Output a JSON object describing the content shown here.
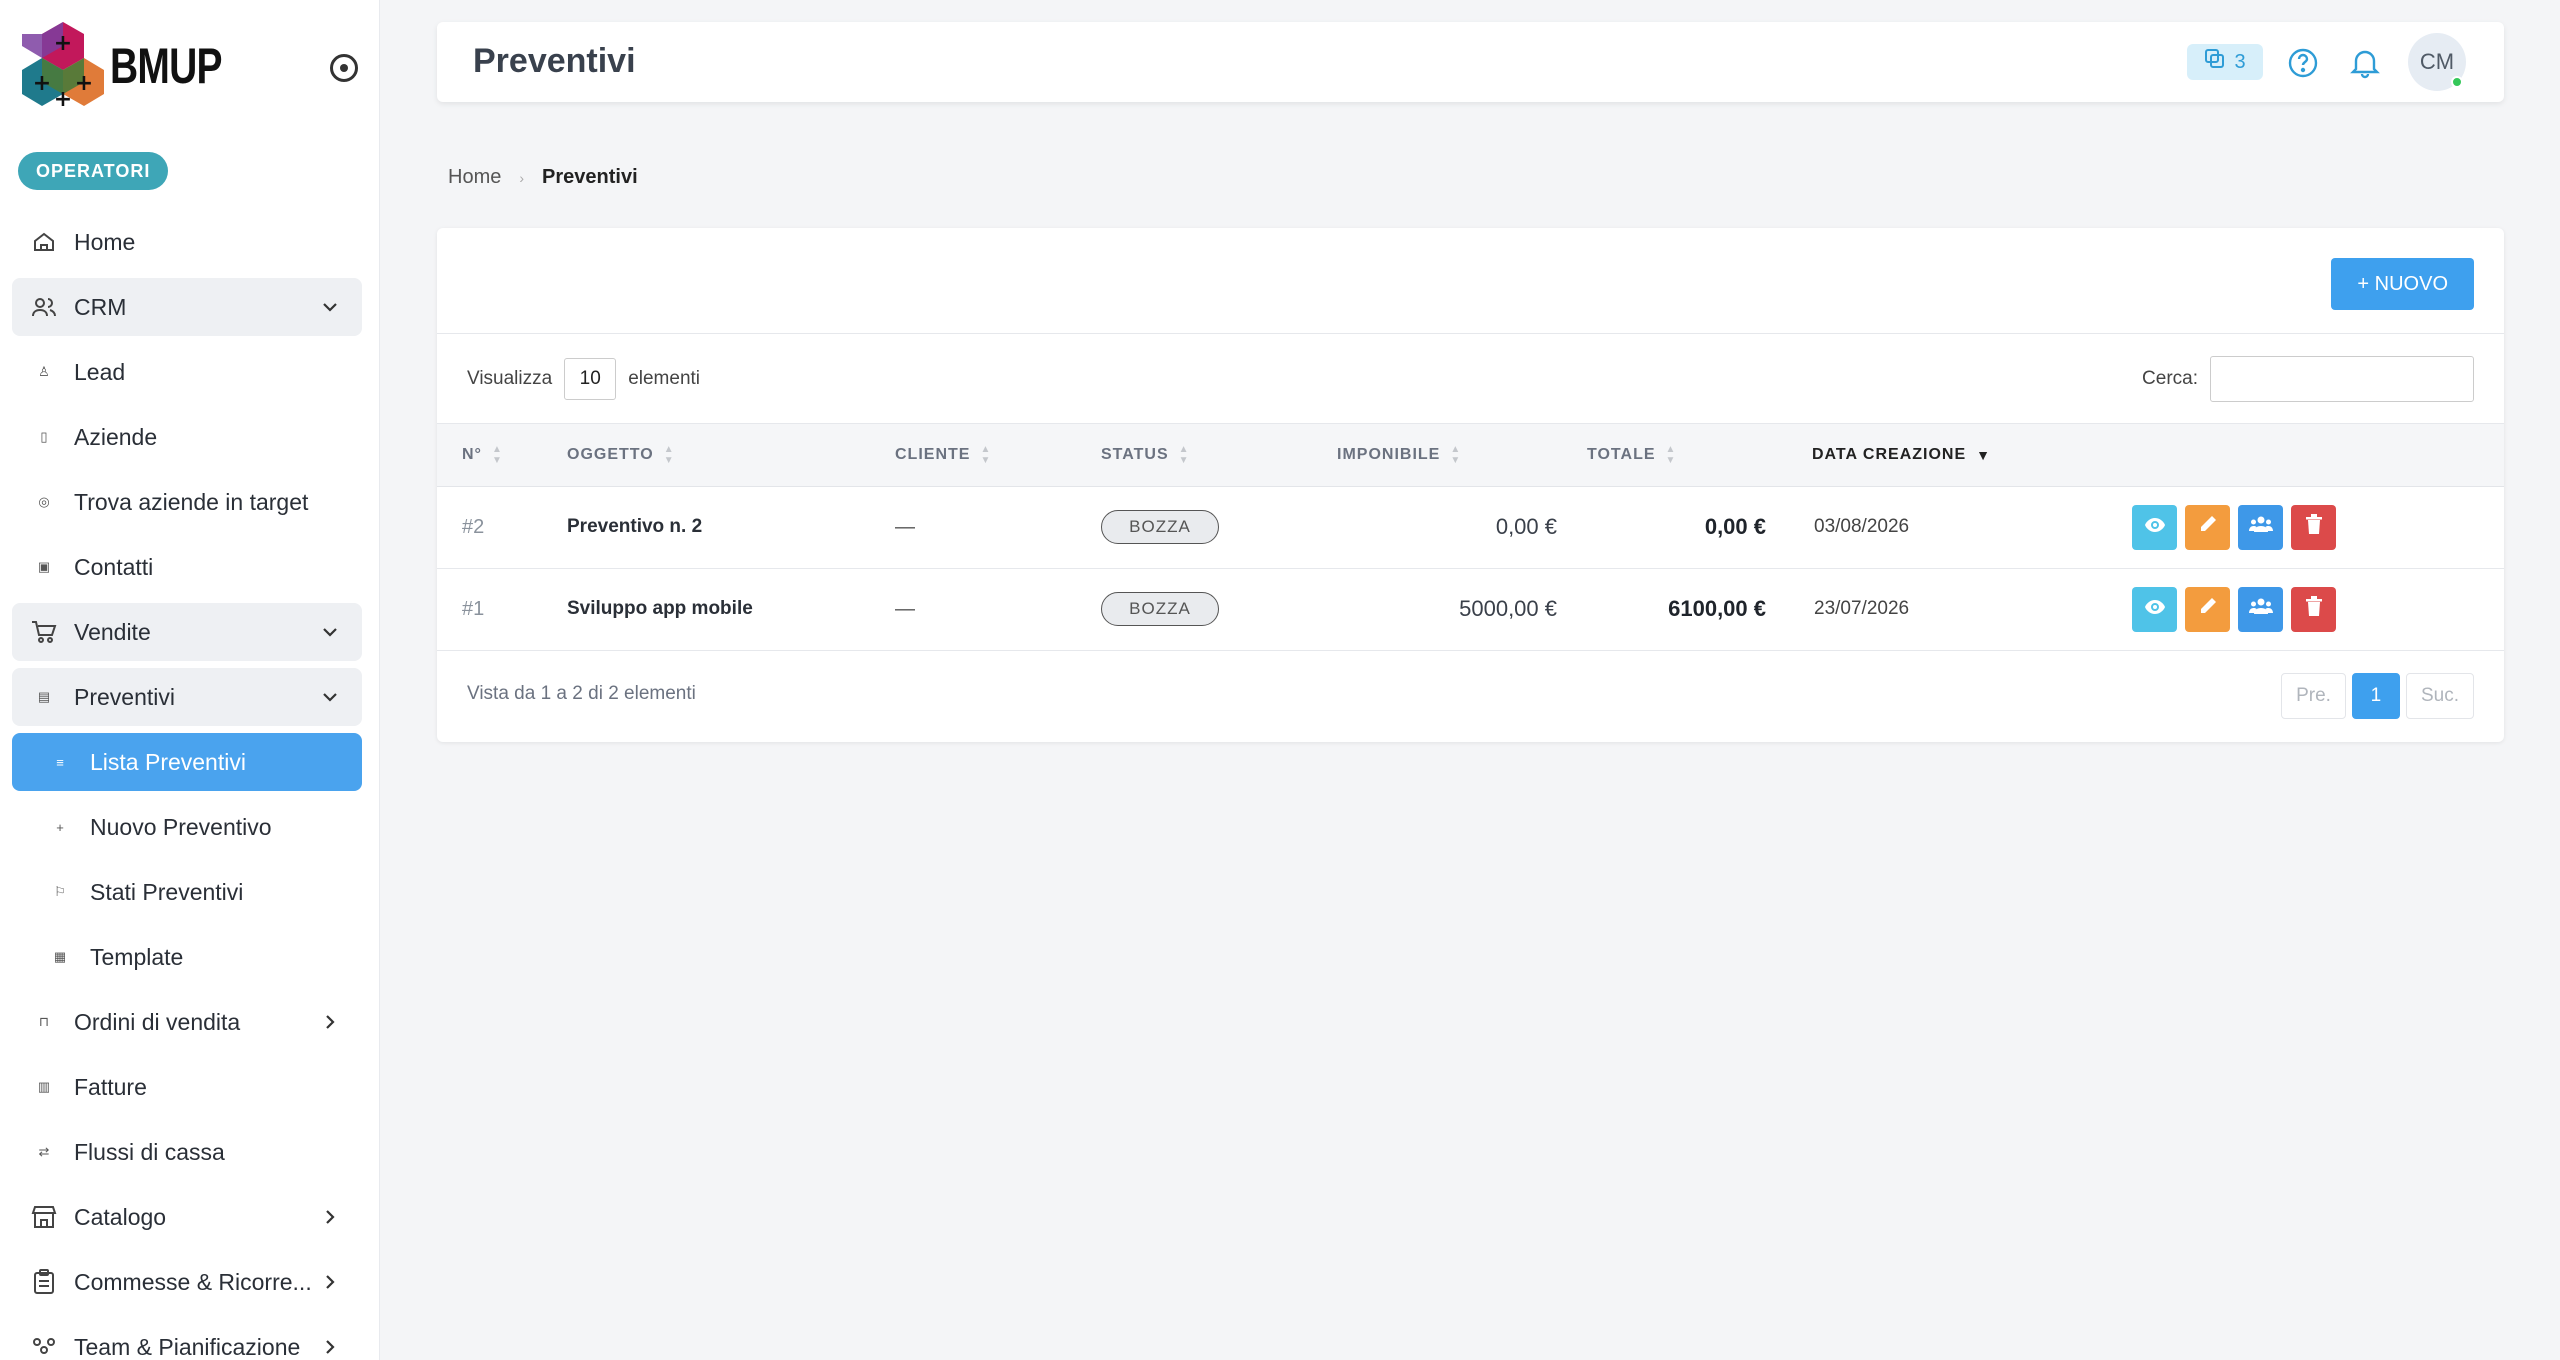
{
  "brand": {
    "name": "BMUP"
  },
  "sidebar": {
    "role_badge": "OPERATORI",
    "items": [
      {
        "label": "Home",
        "icon": "home-icon",
        "kind": "top"
      },
      {
        "label": "CRM",
        "icon": "users-icon",
        "kind": "group",
        "chevron": "down"
      },
      {
        "label": "Lead",
        "icon": "person-icon",
        "kind": "sub"
      },
      {
        "label": "Aziende",
        "icon": "building-icon",
        "kind": "sub"
      },
      {
        "label": "Trova aziende in target",
        "icon": "target-icon",
        "kind": "sub"
      },
      {
        "label": "Contatti",
        "icon": "contact-card-icon",
        "kind": "sub"
      },
      {
        "label": "Vendite",
        "icon": "cart-icon",
        "kind": "group",
        "chevron": "down"
      },
      {
        "label": "Preventivi",
        "icon": "document-icon",
        "kind": "group",
        "chevron": "down"
      },
      {
        "label": "Lista Preventivi",
        "icon": "list-icon",
        "kind": "active"
      },
      {
        "label": "Nuovo Preventivo",
        "icon": "plus-icon",
        "kind": "subsub"
      },
      {
        "label": "Stati Preventivi",
        "icon": "flag-icon",
        "kind": "subsub"
      },
      {
        "label": "Template",
        "icon": "template-icon",
        "kind": "subsub"
      },
      {
        "label": "Ordini di vendita",
        "icon": "bag-icon",
        "kind": "top",
        "chevron": "right"
      },
      {
        "label": "Fatture",
        "icon": "invoice-icon",
        "kind": "top"
      },
      {
        "label": "Flussi di cassa",
        "icon": "flow-icon",
        "kind": "top"
      },
      {
        "label": "Catalogo",
        "icon": "store-icon",
        "kind": "top",
        "chevron": "right"
      },
      {
        "label": "Commesse & Ricorre...",
        "icon": "clipboard-icon",
        "kind": "top",
        "chevron": "right"
      },
      {
        "label": "Team & Pianificazione",
        "icon": "team-icon",
        "kind": "top",
        "chevron": "right"
      }
    ]
  },
  "header": {
    "title": "Preventivi",
    "badge_count": "3",
    "avatar_initials": "CM"
  },
  "breadcrumb": {
    "home": "Home",
    "separator": "›",
    "current": "Preventivi"
  },
  "toolbar": {
    "new_button": "+ NUOVO"
  },
  "table_controls": {
    "show_label": "Visualizza",
    "page_size": "10",
    "show_suffix": "elementi",
    "search_label": "Cerca:"
  },
  "table": {
    "columns": [
      "N°",
      "OGGETTO",
      "CLIENTE",
      "STATUS",
      "IMPONIBILE",
      "TOTALE",
      "DATA CREAZIONE"
    ],
    "rows": [
      {
        "num": "#2",
        "oggetto": "Preventivo n. 2",
        "cliente": "—",
        "status": "BOZZA",
        "imponibile": "0,00 €",
        "totale": "0,00 €",
        "data": "03/08/2026"
      },
      {
        "num": "#1",
        "oggetto": "Sviluppo app mobile",
        "cliente": "—",
        "status": "BOZZA",
        "imponibile": "5000,00 €",
        "totale": "6100,00 €",
        "data": "23/07/2026"
      }
    ]
  },
  "footer": {
    "info": "Vista da 1 a 2 di 2 elementi",
    "prev": "Pre.",
    "current_page": "1",
    "next": "Suc."
  },
  "colors": {
    "accent": "#3ea0ee",
    "badge": "#3ea6b7",
    "view": "#4fc3e8",
    "edit": "#f39c3e",
    "share": "#3e98e8",
    "delete": "#dc4a4a"
  }
}
